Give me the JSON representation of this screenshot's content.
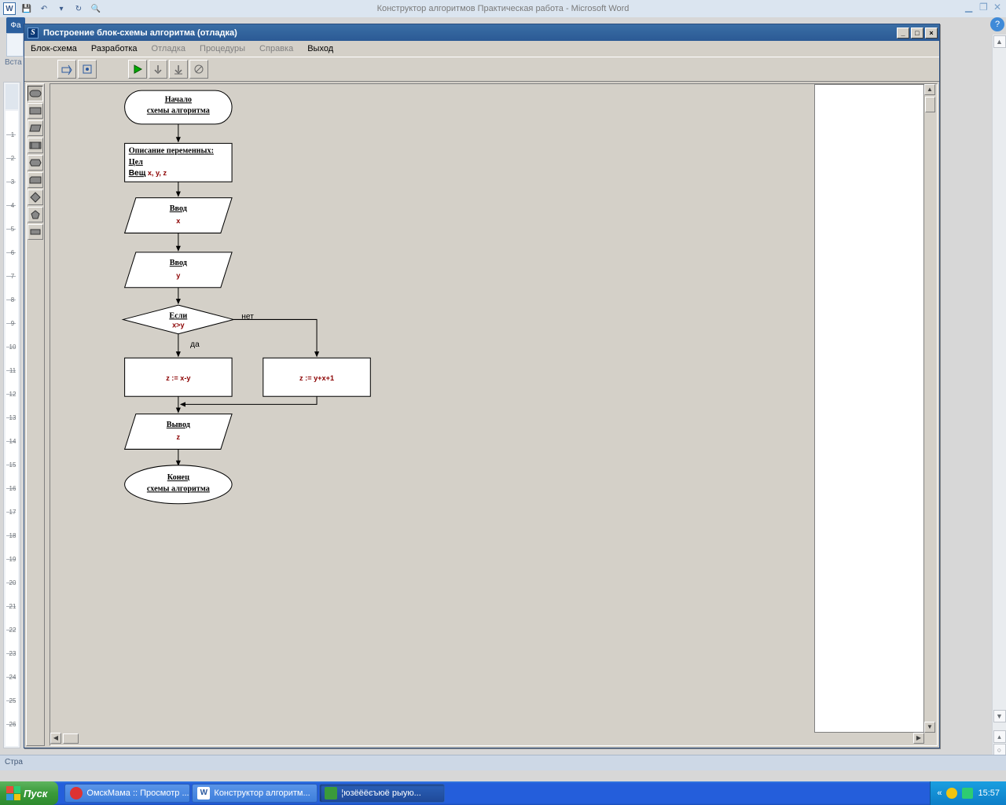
{
  "word": {
    "title": "Конструктор алгоритмов Практическая работа - Microsoft Word",
    "tab": "Фа",
    "ribbon_label": "Вста",
    "status": "Стра"
  },
  "subwin": {
    "title": "Построение блок-схемы алгоритма (отладка)",
    "menu": [
      {
        "label": "Блок-схема",
        "enabled": true
      },
      {
        "label": "Разработка",
        "enabled": true
      },
      {
        "label": "Отладка",
        "enabled": false
      },
      {
        "label": "Процедуры",
        "enabled": false
      },
      {
        "label": "Справка",
        "enabled": false
      },
      {
        "label": "Выход",
        "enabled": true
      }
    ]
  },
  "flowchart": {
    "start": {
      "l1": "Начало",
      "l2": "схемы алгоритма"
    },
    "vars": {
      "l1": "Описание переменных:",
      "l2": "Цел",
      "l3": "Вещ",
      "l3v": "x, y, z"
    },
    "in1": {
      "l1": "Ввод",
      "v": "x"
    },
    "in2": {
      "l1": "Ввод",
      "v": "y"
    },
    "cond": {
      "l1": "Если",
      "v": "x>y",
      "yes": "да",
      "no": "нет"
    },
    "pL": {
      "v": "z := x-y"
    },
    "pR": {
      "v": "z := y+x+1"
    },
    "out": {
      "l1": "Вывод",
      "v": "z"
    },
    "end": {
      "l1": "Конец",
      "l2": "схемы алгоритма"
    }
  },
  "taskbar": {
    "start": "Пуск",
    "btns": [
      {
        "label": "ОмскМама :: Просмотр ...",
        "active": false,
        "color": "#d33"
      },
      {
        "label": "Конструктор алгоритм...",
        "active": false,
        "color": "#2c5aa0"
      },
      {
        "label": "¦юзёёёєъюё рыую...",
        "active": true,
        "color": "#3a9a3a"
      }
    ],
    "clock": "15:57",
    "chev": "«"
  }
}
